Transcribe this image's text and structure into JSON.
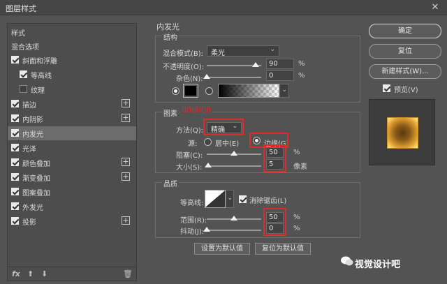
{
  "window": {
    "title": "图层样式",
    "close_symbol": "✕"
  },
  "left_panel": {
    "header": "样式",
    "blend_options": "混合选项",
    "items": [
      {
        "label": "斜面和浮雕",
        "checked": true,
        "plus": false,
        "indent": false
      },
      {
        "label": "等高线",
        "checked": true,
        "plus": false,
        "indent": true
      },
      {
        "label": "纹理",
        "checked": false,
        "plus": false,
        "indent": true
      },
      {
        "label": "描边",
        "checked": true,
        "plus": true,
        "indent": false
      },
      {
        "label": "内阴影",
        "checked": true,
        "plus": true,
        "indent": false
      },
      {
        "label": "内发光",
        "checked": true,
        "plus": false,
        "indent": false,
        "selected": true
      },
      {
        "label": "光泽",
        "checked": true,
        "plus": false,
        "indent": false
      },
      {
        "label": "颜色叠加",
        "checked": true,
        "plus": true,
        "indent": false
      },
      {
        "label": "渐变叠加",
        "checked": true,
        "plus": true,
        "indent": false
      },
      {
        "label": "图案叠加",
        "checked": true,
        "plus": false,
        "indent": false
      },
      {
        "label": "外发光",
        "checked": true,
        "plus": false,
        "indent": false
      },
      {
        "label": "投影",
        "checked": true,
        "plus": true,
        "indent": false
      }
    ],
    "plus_symbol": "+",
    "bottom": {
      "fx": "fx",
      "up": "⬆",
      "down": "⬇",
      "trash": "🗑"
    }
  },
  "inner_glow": {
    "section_title": "内发光",
    "structure": {
      "title": "结构",
      "blend_mode_label": "混合模式(B):",
      "blend_mode_value": "柔光",
      "opacity_label": "不透明度(O):",
      "opacity_value": "90",
      "opacity_pct": 90,
      "noise_label": "杂色(N):",
      "noise_value": "0",
      "noise_pct": 0,
      "unit_pct": "%"
    },
    "elements": {
      "title": "图素",
      "color_hex_note": "000000",
      "method_label": "方法(Q):",
      "method_value": "精确",
      "source_label": "源:",
      "source_center": "居中(E)",
      "source_edge": "边缘(G)",
      "choke_label": "阻塞(C):",
      "choke_value": "50",
      "choke_pct": 50,
      "size_label": "大小(S):",
      "size_value": "5",
      "size_unit": "像素",
      "size_pct": 2
    },
    "quality": {
      "title": "品质",
      "contour_label": "等高线:",
      "antialias_label": "消除锯齿(L)",
      "range_label": "范围(R):",
      "range_value": "50",
      "range_pct": 50,
      "jitter_label": "抖动(J):",
      "jitter_value": "0",
      "jitter_pct": 0
    },
    "set_default": "设置为默认值",
    "reset_default": "复位为默认值"
  },
  "right_panel": {
    "ok": "确定",
    "reset": "复位",
    "new_style": "新建样式(W)...",
    "preview_label": "预览(V)"
  },
  "watermark": "视觉设计吧",
  "colors": {
    "glow_color": "#000000",
    "highlight": "#e02a2a",
    "note_color": "#e02a2a"
  }
}
